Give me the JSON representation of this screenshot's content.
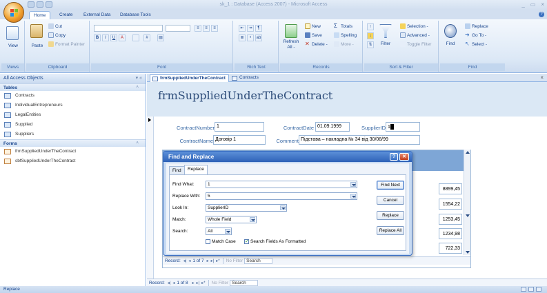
{
  "window": {
    "title": "sk_1 : Database (Access 2007) - Microsoft Access",
    "controls": [
      "_",
      "▭",
      "×"
    ]
  },
  "ribbon": {
    "tabs": [
      "Home",
      "Create",
      "External Data",
      "Database Tools"
    ],
    "active_tab": "Home",
    "groups": {
      "views": {
        "label": "Views",
        "view": "View"
      },
      "clipboard": {
        "label": "Clipboard",
        "paste": "Paste",
        "cut": "Cut",
        "copy": "Copy",
        "format_painter": "Format Painter"
      },
      "font": {
        "label": "Font"
      },
      "rich_text": {
        "label": "Rich Text"
      },
      "records": {
        "label": "Records",
        "refresh": "Refresh",
        "refresh_sub": "All -",
        "new": "New",
        "save": "Save",
        "delete": "Delete -",
        "totals": "Totals",
        "spelling": "Spelling",
        "more": "More -"
      },
      "sort_filter": {
        "label": "Sort & Filter",
        "filter": "Filter",
        "selection": "Selection -",
        "advanced": "Advanced -",
        "toggle_filter": "Toggle Filter"
      },
      "find": {
        "label": "Find",
        "find": "Find",
        "replace": "Replace",
        "go_to": "Go To -",
        "select": "Select -"
      }
    }
  },
  "nav": {
    "header": "All Access Objects",
    "sections": [
      {
        "title": "Tables",
        "items": [
          "Contracts",
          "IndividualEntrepreneurs",
          "LegalEntities",
          "Supplied",
          "Suppliers"
        ]
      },
      {
        "title": "Forms",
        "items": [
          "frmSuppliedUnderTheContract",
          "sbfSuppliedUnderTheContract"
        ]
      }
    ]
  },
  "doc_tabs": [
    "frmSuppliedUnderTheContract",
    "Contracts"
  ],
  "form": {
    "title": "frmSuppliedUnderTheContract",
    "fields": {
      "contract_number": {
        "label": "ContractNumber",
        "value": "1"
      },
      "contract_date": {
        "label": "ContractDate",
        "value": "01.09.1999"
      },
      "supplier_id": {
        "label": "SupplierID",
        "value": "1"
      },
      "contract_name": {
        "label": "ContractName",
        "value": "Договір 1"
      },
      "comment": {
        "label": "Comment",
        "value": "Підстава – накладна № 34 від 30/08/99"
      }
    },
    "subform_amounts": [
      "8899,45",
      "1554,22",
      "1253,45",
      "1234,98",
      "722,33"
    ],
    "subform_nav": {
      "record_label": "Record:",
      "current": "1 of 7",
      "no_filter": "No Filter",
      "search": "Search"
    },
    "main_nav": {
      "record_label": "Record:",
      "current": "1 of 8",
      "no_filter": "No Filter",
      "search": "Search"
    }
  },
  "dialog": {
    "title": "Find and Replace",
    "tabs": [
      "Find",
      "Replace"
    ],
    "active_tab": "Replace",
    "find_what": {
      "label": "Find What:",
      "value": "1"
    },
    "replace_with": {
      "label": "Replace With:",
      "value": "5"
    },
    "look_in": {
      "label": "Look In:",
      "value": "SupplierID"
    },
    "match": {
      "label": "Match:",
      "value": "Whole Field"
    },
    "search": {
      "label": "Search:",
      "value": "All"
    },
    "match_case": {
      "label": "Match Case",
      "checked": false
    },
    "search_formatted": {
      "label": "Search Fields As Formatted",
      "checked": true
    },
    "buttons": {
      "find_next": "Find Next",
      "cancel": "Cancel",
      "replace": "Replace",
      "replace_all": "Replace All"
    }
  },
  "status": {
    "text": "Replace"
  }
}
